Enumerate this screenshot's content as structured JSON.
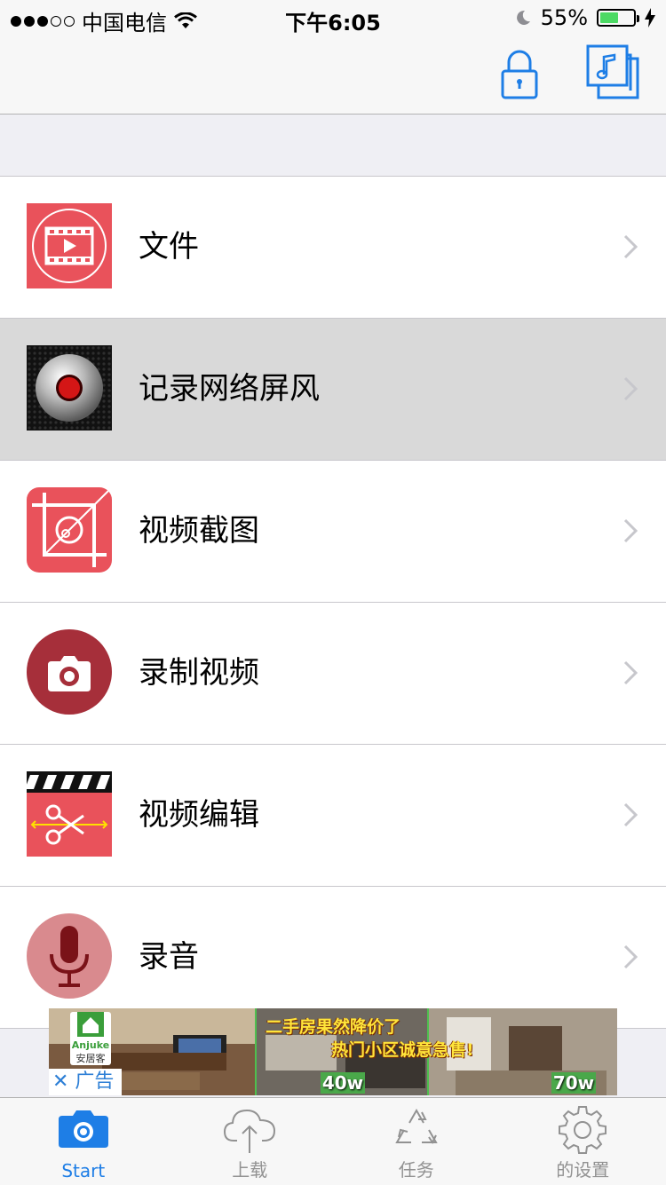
{
  "status_bar": {
    "carrier": "中国电信",
    "time": "下午6:05",
    "battery_percent": "55%",
    "battery_level": 0.55
  },
  "nav_bar": {
    "icons": [
      "lock-icon",
      "music-library-icon"
    ]
  },
  "menu": {
    "items": [
      {
        "label": "文件",
        "icon": "film-play-icon",
        "color": "#e9525b"
      },
      {
        "label": "记录网络屏风",
        "icon": "record-disc-icon",
        "color": "#000000"
      },
      {
        "label": "视频截图",
        "icon": "crop-icon",
        "color": "#e9525b"
      },
      {
        "label": "录制视频",
        "icon": "camera-icon",
        "color": "#a62f3a"
      },
      {
        "label": "视频编辑",
        "icon": "clapper-scissors-icon",
        "color": "#e9525b"
      },
      {
        "label": "录音",
        "icon": "microphone-icon",
        "color": "#d98a8e"
      }
    ]
  },
  "ad": {
    "logo_text": "Anjuke",
    "logo_sub": "安居客",
    "headline_1": "二手房果然降价了",
    "headline_2": "热门小区诚意急售!",
    "price_1": "40w",
    "price_2": "70w",
    "close_label": "✕ 广告"
  },
  "tab_bar": {
    "tabs": [
      {
        "label": "Start",
        "icon": "camera-icon",
        "active": true
      },
      {
        "label": "上载",
        "icon": "cloud-upload-icon",
        "active": false
      },
      {
        "label": "任务",
        "icon": "recycle-icon",
        "active": false
      },
      {
        "label": "的设置",
        "icon": "gear-icon",
        "active": false
      }
    ]
  },
  "colors": {
    "accent": "#1e7ee6",
    "icon_red": "#e9525b",
    "row_highlight": "#d9d9d9",
    "battery_green": "#4cd964"
  }
}
